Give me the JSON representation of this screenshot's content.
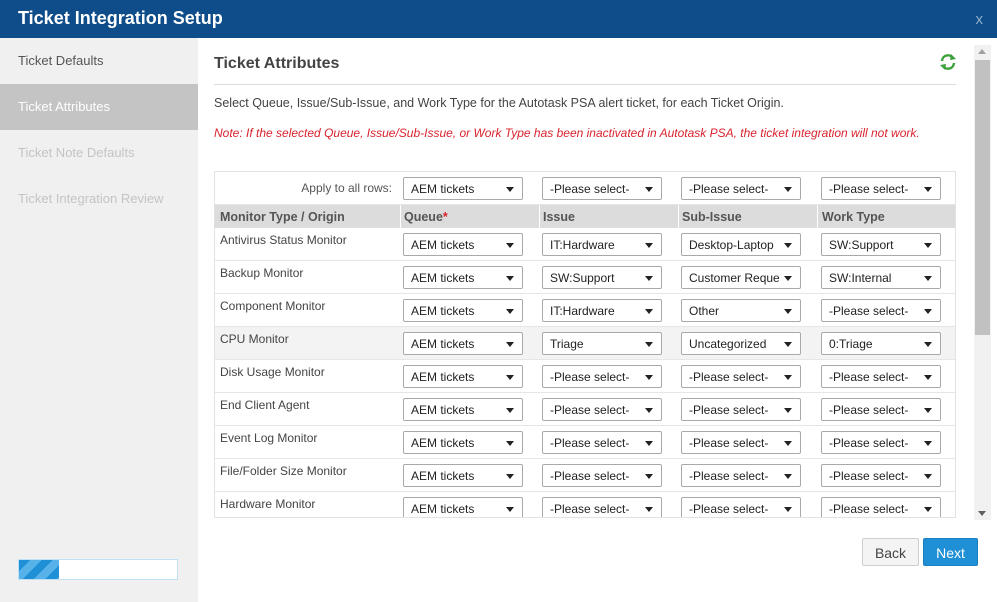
{
  "window": {
    "title": "Ticket Integration Setup",
    "close_icon": "x"
  },
  "sidebar": {
    "items": [
      {
        "label": "Ticket Defaults",
        "state": "normal"
      },
      {
        "label": "Ticket Attributes",
        "state": "active"
      },
      {
        "label": "Ticket Note Defaults",
        "state": "disabled"
      },
      {
        "label": "Ticket Integration Review",
        "state": "disabled"
      }
    ],
    "progress_fraction": 0.25
  },
  "main": {
    "title": "Ticket Attributes",
    "refresh_icon": "refresh-icon",
    "description": "Select Queue, Issue/Sub-Issue, and Work Type for the Autotask PSA alert ticket, for each Ticket Origin.",
    "note": "Note: If the selected Queue, Issue/Sub-Issue, or Work Type has been inactivated in Autotask PSA, the ticket integration will not work."
  },
  "table": {
    "apply_label": "Apply to all rows:",
    "apply_values": [
      "AEM tickets",
      "-Please select-",
      "-Please select-",
      "-Please select-"
    ],
    "headers": {
      "origin": "Monitor Type / Origin",
      "queue": "Queue",
      "required_mark": "*",
      "issue": "Issue",
      "subissue": "Sub-Issue",
      "worktype": "Work Type"
    },
    "rows": [
      {
        "name": "Antivirus Status Monitor",
        "queue": "AEM tickets",
        "issue": "IT:Hardware",
        "subissue": "Desktop-Laptop",
        "worktype": "SW:Support"
      },
      {
        "name": "Backup Monitor",
        "queue": "AEM tickets",
        "issue": "SW:Support",
        "subissue": "Customer Reque",
        "worktype": "SW:Internal"
      },
      {
        "name": "Component Monitor",
        "queue": "AEM tickets",
        "issue": "IT:Hardware",
        "subissue": "Other",
        "worktype": "-Please select-"
      },
      {
        "name": "CPU Monitor",
        "queue": "AEM tickets",
        "issue": "Triage",
        "subissue": "Uncategorized",
        "worktype": "0:Triage"
      },
      {
        "name": "Disk Usage Monitor",
        "queue": "AEM tickets",
        "issue": "-Please select-",
        "subissue": "-Please select-",
        "worktype": "-Please select-"
      },
      {
        "name": "End Client Agent",
        "queue": "AEM tickets",
        "issue": "-Please select-",
        "subissue": "-Please select-",
        "worktype": "-Please select-"
      },
      {
        "name": "Event Log Monitor",
        "queue": "AEM tickets",
        "issue": "-Please select-",
        "subissue": "-Please select-",
        "worktype": "-Please select-"
      },
      {
        "name": "File/Folder Size Monitor",
        "queue": "AEM tickets",
        "issue": "-Please select-",
        "subissue": "-Please select-",
        "worktype": "-Please select-"
      },
      {
        "name": "Hardware Monitor",
        "queue": "AEM tickets",
        "issue": "-Please select-",
        "subissue": "-Please select-",
        "worktype": "-Please select-"
      }
    ]
  },
  "footer": {
    "back_label": "Back",
    "next_label": "Next"
  }
}
